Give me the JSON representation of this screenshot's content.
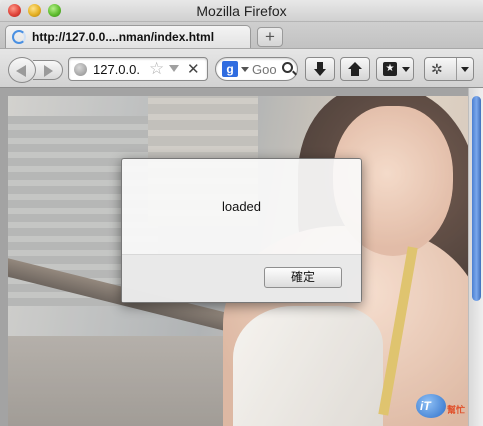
{
  "window": {
    "title": "Mozilla Firefox"
  },
  "tabs": [
    {
      "label": "http://127.0.0....nman/index.html"
    }
  ],
  "newtab_symbol": "+",
  "toolbar": {
    "url_value": "127.0.0.",
    "search_engine": "g",
    "search_placeholder": "Goo",
    "stop_symbol": "✕",
    "star_symbol": "☆",
    "bookmarks_glyph": "★",
    "addon_glyph": "✲"
  },
  "dialog": {
    "message": "loaded",
    "ok_label": "確定"
  },
  "watermark": {
    "logo_text": "iT",
    "sub_text": "幫忙"
  },
  "icons": {
    "back": "back-arrow-icon",
    "forward": "forward-arrow-icon",
    "download": "download-arrow-icon",
    "home": "home-icon",
    "bookmarks": "bookmarks-icon"
  },
  "colors": {
    "scroll_thumb": "#4b7fd1",
    "google_icon": "#2f6ce0"
  }
}
